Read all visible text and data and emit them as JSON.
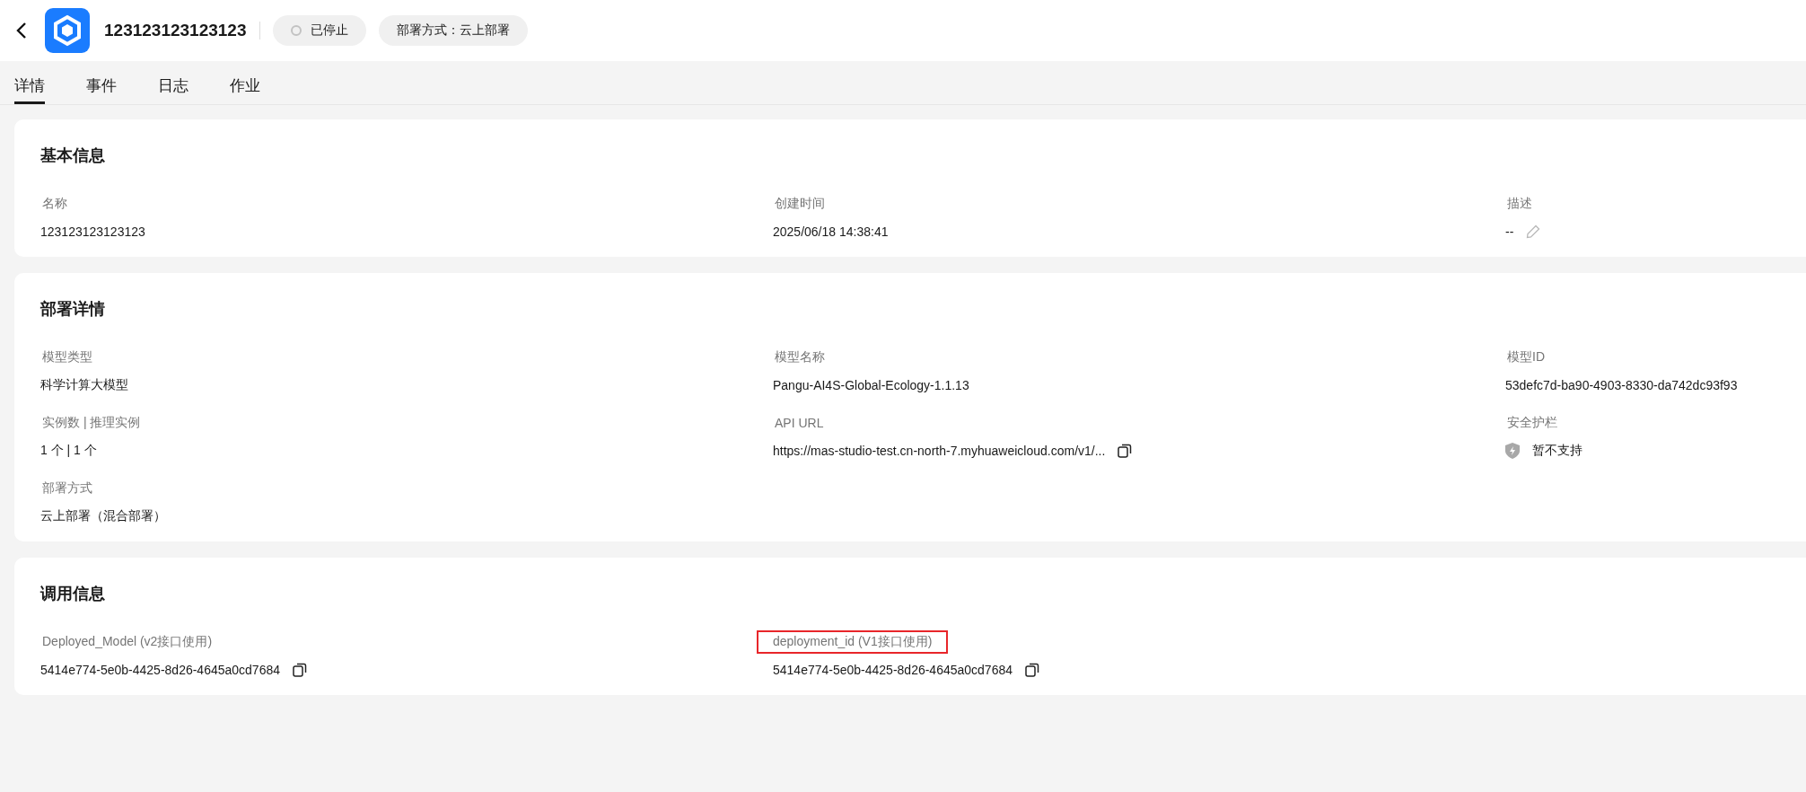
{
  "header": {
    "title": "123123123123123",
    "status": "已停止",
    "deploy_tag": "部署方式：云上部署"
  },
  "tabs": [
    {
      "label": "详情",
      "selected": true
    },
    {
      "label": "事件",
      "selected": false
    },
    {
      "label": "日志",
      "selected": false
    },
    {
      "label": "作业",
      "selected": false
    }
  ],
  "sections": [
    {
      "title": "基本信息",
      "fields": [
        {
          "label": "名称",
          "value": "123123123123123",
          "kind": "text",
          "highlighted": false
        },
        {
          "label": "创建时间",
          "value": "2025/06/18 14:38:41",
          "kind": "text",
          "highlighted": false
        },
        {
          "label": "描述",
          "value": "--",
          "kind": "edit",
          "highlighted": false
        }
      ]
    },
    {
      "title": "部署详情",
      "fields": [
        {
          "label": "模型类型",
          "value": "科学计算大模型",
          "kind": "text",
          "highlighted": false
        },
        {
          "label": "模型名称",
          "value": "Pangu-AI4S-Global-Ecology-1.1.13",
          "kind": "text",
          "highlighted": false
        },
        {
          "label": "模型ID",
          "value": "53defc7d-ba90-4903-8330-da742dc93f93",
          "kind": "text",
          "highlighted": false
        },
        {
          "label": "实例数 | 推理实例",
          "value": "1 个 | 1 个",
          "kind": "text",
          "highlighted": false
        },
        {
          "label": "API URL",
          "value": "https://mas-studio-test.cn-north-7.myhuaweicloud.com/v1/...",
          "kind": "copy",
          "highlighted": false
        },
        {
          "label": "安全护栏",
          "value": "暂不支持",
          "kind": "shield",
          "highlighted": false
        },
        {
          "label": "部署方式",
          "value": "云上部署（混合部署）",
          "kind": "text",
          "highlighted": false
        }
      ]
    },
    {
      "title": "调用信息",
      "fields": [
        {
          "label": "Deployed_Model (v2接口使用)",
          "value": "5414e774-5e0b-4425-8d26-4645a0cd7684",
          "kind": "copy",
          "highlighted": false
        },
        {
          "label": "deployment_id (V1接口使用)",
          "value": "5414e774-5e0b-4425-8d26-4645a0cd7684",
          "kind": "copy",
          "highlighted": true
        }
      ]
    }
  ]
}
